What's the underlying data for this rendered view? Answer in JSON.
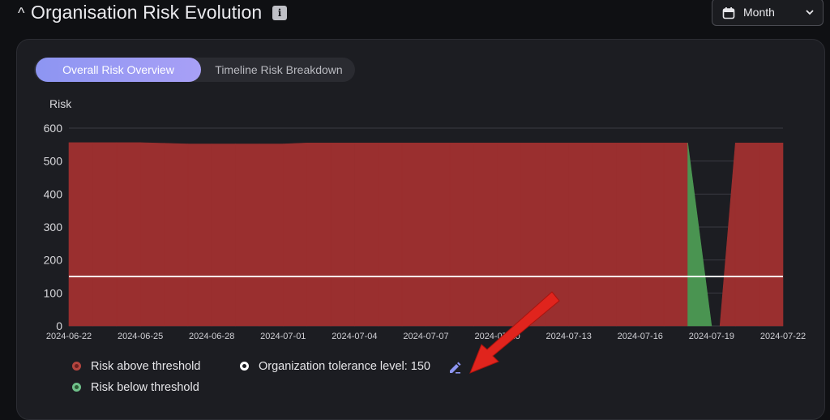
{
  "header": {
    "collapse_glyph": "^",
    "title": "Organisation Risk Evolution",
    "info_glyph": "i",
    "period_select": {
      "value": "Month",
      "icon": "calendar-icon"
    }
  },
  "tabs": [
    {
      "label": "Overall Risk Overview",
      "active": true
    },
    {
      "label": "Timeline Risk Breakdown",
      "active": false
    }
  ],
  "chart_data": {
    "type": "area",
    "ylabel": "Risk",
    "xlabel": "",
    "ylim": [
      0,
      600
    ],
    "yticks": [
      0,
      100,
      200,
      300,
      400,
      500,
      600
    ],
    "xtick_labels": [
      "2024-06-22",
      "2024-06-25",
      "2024-06-28",
      "2024-07-01",
      "2024-07-04",
      "2024-07-07",
      "2024-07-10",
      "2024-07-13",
      "2024-07-16",
      "2024-07-19",
      "2024-07-22"
    ],
    "threshold": 150,
    "x": [
      "2024-06-22",
      "2024-06-23",
      "2024-06-24",
      "2024-06-25",
      "2024-06-26",
      "2024-06-27",
      "2024-06-28",
      "2024-06-29",
      "2024-06-30",
      "2024-07-01",
      "2024-07-02",
      "2024-07-03",
      "2024-07-04",
      "2024-07-05",
      "2024-07-06",
      "2024-07-07",
      "2024-07-08",
      "2024-07-09",
      "2024-07-10",
      "2024-07-11",
      "2024-07-12",
      "2024-07-13",
      "2024-07-14",
      "2024-07-15",
      "2024-07-16",
      "2024-07-17",
      "2024-07-18",
      "2024-07-19",
      "2024-07-20",
      "2024-07-21",
      "2024-07-22"
    ],
    "y": [
      556,
      556,
      556,
      556,
      554,
      552,
      552,
      552,
      552,
      552,
      555,
      555,
      555,
      555,
      555,
      555,
      555,
      555,
      555,
      555,
      555,
      555,
      555,
      555,
      555,
      555,
      555,
      0,
      555,
      555,
      555
    ],
    "series": [
      {
        "name": "Risk above threshold",
        "color": "#9a2f2f"
      },
      {
        "name": "Risk below threshold",
        "color": "#4a9451"
      }
    ],
    "grid": true,
    "legend_position": "bottom-left"
  },
  "legend": {
    "above": "Risk above threshold",
    "below": "Risk below threshold",
    "tolerance": "Organization tolerance level: 150",
    "edit_icon": "edit-pencil-icon"
  },
  "colors": {
    "above": "#9a2f2f",
    "below": "#4a9451",
    "threshold_line": "#ffffff",
    "tab_accent": "#8d95f2",
    "annotation_arrow": "#e0241d"
  }
}
